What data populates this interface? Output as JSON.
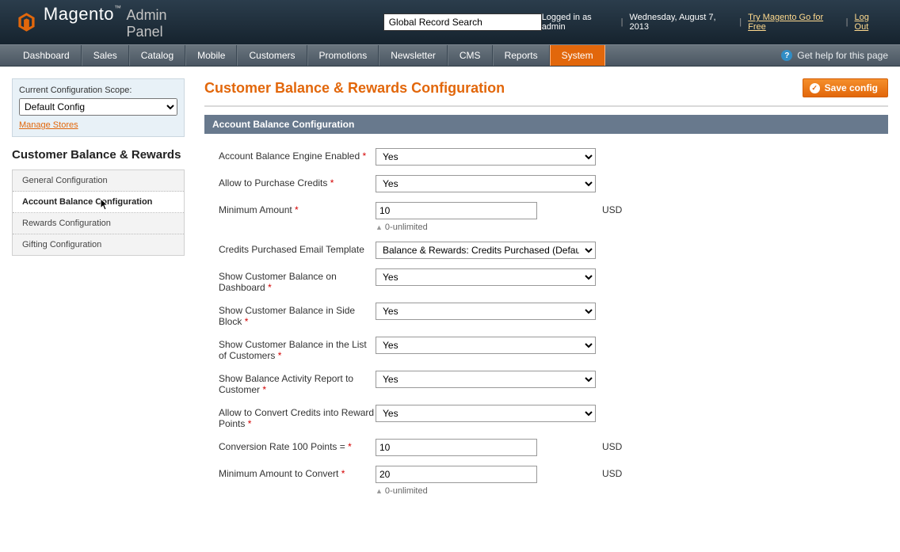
{
  "header": {
    "brand": "Magento",
    "brand_tm": "™",
    "subtitle": "Admin Panel",
    "search_placeholder": "Global Record Search",
    "logged_in": "Logged in as admin",
    "date": "Wednesday, August 7, 2013",
    "try_link": "Try Magento Go for Free",
    "logout": "Log Out"
  },
  "topmenu": {
    "items": [
      "Dashboard",
      "Sales",
      "Catalog",
      "Mobile",
      "Customers",
      "Promotions",
      "Newsletter",
      "CMS",
      "Reports",
      "System"
    ],
    "active_index": 9,
    "help": "Get help for this page"
  },
  "sidebar": {
    "scope_label": "Current Configuration Scope:",
    "scope_value": "Default Config",
    "manage_link": "Manage Stores",
    "section_title": "Customer Balance & Rewards",
    "nav": [
      {
        "label": "General Configuration"
      },
      {
        "label": "Account Balance Configuration"
      },
      {
        "label": "Rewards Configuration"
      },
      {
        "label": "Gifting Configuration"
      }
    ],
    "selected_index": 1
  },
  "content": {
    "title": "Customer Balance & Rewards Configuration",
    "save_button": "Save config",
    "section_head": "Account Balance Configuration",
    "fields": {
      "engine_enabled": {
        "label": "Account Balance Engine Enabled",
        "value": "Yes"
      },
      "allow_purchase": {
        "label": "Allow to Purchase Credits",
        "value": "Yes"
      },
      "min_amount": {
        "label": "Minimum Amount",
        "value": "10",
        "after": "USD",
        "hint": "0-unlimited"
      },
      "email_template": {
        "label": "Credits Purchased Email Template",
        "value": "Balance & Rewards: Credits Purchased (Default Template)"
      },
      "show_dashboard": {
        "label": "Show Customer Balance on Dashboard",
        "value": "Yes"
      },
      "show_side_block": {
        "label": "Show Customer Balance in Side Block",
        "value": "Yes"
      },
      "show_list": {
        "label": "Show Customer Balance in the List of Customers",
        "value": "Yes"
      },
      "show_activity": {
        "label": "Show Balance Activity Report to Customer",
        "value": "Yes"
      },
      "allow_convert": {
        "label": "Allow to Convert Credits into Reward Points",
        "value": "Yes"
      },
      "conversion_rate": {
        "label": "Conversion Rate 100 Points =",
        "value": "10",
        "after": "USD"
      },
      "min_convert": {
        "label": "Minimum Amount to Convert",
        "value": "20",
        "after": "USD",
        "hint": "0-unlimited"
      }
    }
  }
}
